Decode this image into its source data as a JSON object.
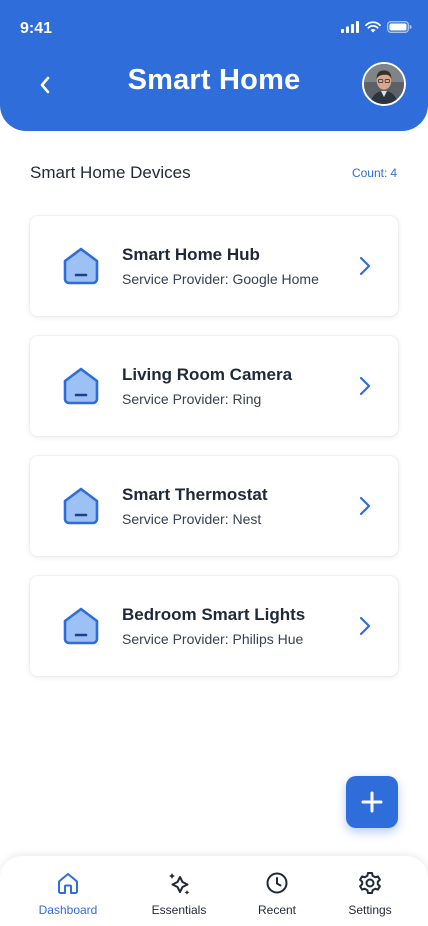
{
  "status_bar": {
    "time": "9:41"
  },
  "header": {
    "title": "Smart Home"
  },
  "section": {
    "title": "Smart Home Devices",
    "count_label": "Count:",
    "count_value": "4"
  },
  "devices": [
    {
      "name": "Smart Home Hub",
      "provider": "Service Provider: Google Home"
    },
    {
      "name": "Living Room Camera",
      "provider": "Service Provider: Ring"
    },
    {
      "name": "Smart Thermostat",
      "provider": "Service Provider: Nest"
    },
    {
      "name": "Bedroom Smart Lights",
      "provider": "Service Provider: Philips Hue"
    }
  ],
  "nav": [
    {
      "label": "Dashboard",
      "icon": "home-icon",
      "active": true
    },
    {
      "label": "Essentials",
      "icon": "sparkle-icon",
      "active": false
    },
    {
      "label": "Recent",
      "icon": "clock-icon",
      "active": false
    },
    {
      "label": "Settings",
      "icon": "gear-icon",
      "active": false
    }
  ],
  "colors": {
    "primary": "#2f6ddb",
    "icon_fill": "#9dc0f5",
    "text": "#1f2937"
  }
}
